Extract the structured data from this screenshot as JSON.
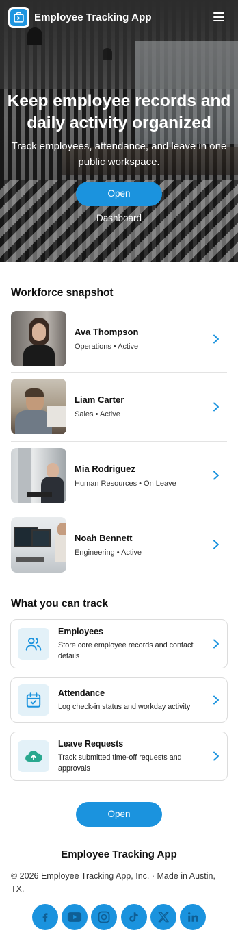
{
  "header": {
    "app_title": "Employee Tracking App",
    "menu_icon": "menu-icon",
    "logo_icon": "dashboard-logo-icon"
  },
  "hero": {
    "title": "Keep employee records and daily activity organized",
    "subtitle": "Track employees, attendance, and leave in one public workspace.",
    "cta_label": "Open Dashboard"
  },
  "snapshot": {
    "title": "Workforce snapshot",
    "items": [
      {
        "name": "Ava Thompson",
        "meta": "Operations • Active"
      },
      {
        "name": "Liam Carter",
        "meta": "Sales • Active"
      },
      {
        "name": "Mia Rodriguez",
        "meta": "Human Resources • On Leave"
      },
      {
        "name": "Noah Bennett",
        "meta": "Engineering • Active"
      }
    ]
  },
  "track": {
    "title": "What you can track",
    "items": [
      {
        "name": "Employees",
        "desc": "Store core employee records and contact details",
        "icon": "users-icon"
      },
      {
        "name": "Attendance",
        "desc": "Log check-in status and workday activity",
        "icon": "calendar-check-icon"
      },
      {
        "name": "Leave Requests",
        "desc": "Track submitted time-off requests and approvals",
        "icon": "cloud-icon"
      }
    ],
    "cta_label": "Open Dashboard"
  },
  "footer": {
    "title": "Employee Tracking App",
    "copyright": "© 2026 Employee Tracking App, Inc. · Made in Austin, TX.",
    "socials": [
      "facebook-icon",
      "youtube-icon",
      "instagram-icon",
      "tiktok-icon",
      "x-icon",
      "linkedin-icon"
    ]
  },
  "colors": {
    "accent": "#1b93de",
    "icon_tile": "#e3f1f8",
    "icon_stroke": "#1b93de",
    "cloud": "#2aa88f"
  }
}
